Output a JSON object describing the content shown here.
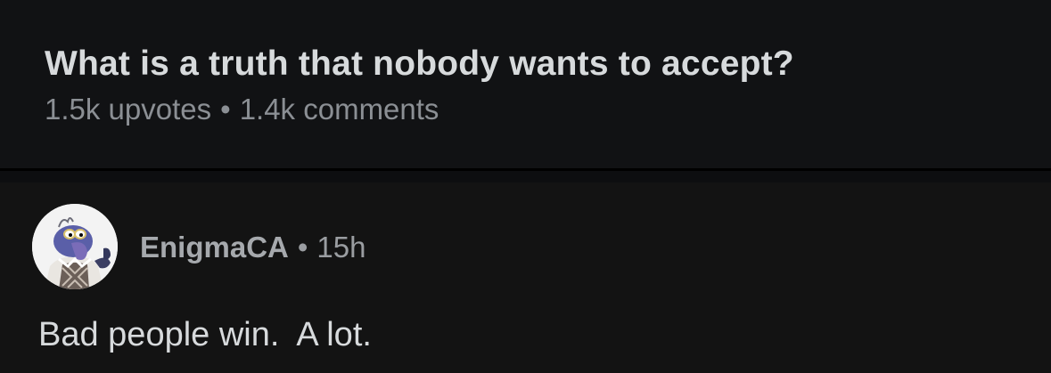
{
  "post": {
    "title": "What is a truth that nobody wants to accept?",
    "upvotes": "1.5k upvotes",
    "separator": "•",
    "comments": "1.4k comments"
  },
  "comment": {
    "avatar_icon": "muppet-avatar-icon",
    "author": "EnigmaCA",
    "separator": "•",
    "time": "15h",
    "body": "Bad people win.  A lot."
  }
}
